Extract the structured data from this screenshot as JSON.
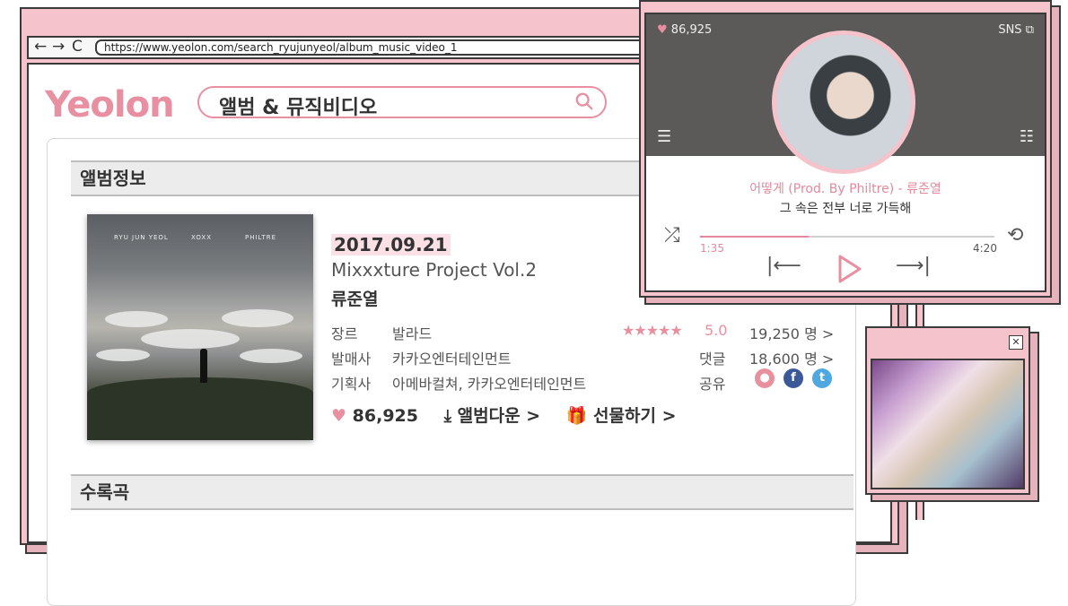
{
  "browser": {
    "url": "https://www.yeolon.com/search_ryujunyeol/album_music_video_1",
    "back_icon": "←",
    "forward_icon": "→",
    "reload_icon": "C"
  },
  "site": {
    "logo": "Yeolon",
    "search_text": "앨범 & 뮤직비디오"
  },
  "album_section": {
    "header": "앨범정보",
    "art": {
      "left_text": "RYU JUN YEOL",
      "mid_text": "XOXX",
      "right_text": "PHILTRE"
    },
    "date": "2017.09.21",
    "title": "Mixxxture Project Vol.2",
    "artist": "류준열",
    "info": [
      {
        "label": "장르",
        "value": "발라드"
      },
      {
        "label": "발매사",
        "value": "카카오엔터테인먼트"
      },
      {
        "label": "기획사",
        "value": "아메바컬쳐, 카카오엔터테인먼트"
      }
    ],
    "rating_stars": "★★★★★",
    "rating_value": "5.0",
    "rating_count": "19,250 명  >",
    "comments_label": "댓글",
    "comments_count": "18,600 명  >",
    "share_label": "공유",
    "likes": "86,925",
    "download_label": "앨범다운 >",
    "gift_label": "선물하기 >"
  },
  "tracks_section": {
    "header": "수록곡"
  },
  "player": {
    "likes": "86,925",
    "sns_label": "SNS",
    "song": "어떻게 (Prod. By Philtre) - 류준열",
    "lyric": "그 속은 전부 너로 가득해",
    "time_current": "1:35",
    "time_total": "4:20",
    "progress": 0.37
  },
  "colors": {
    "accent": "#e88fa1",
    "frame": "#f4c3cb",
    "border": "#3a3a3a"
  }
}
